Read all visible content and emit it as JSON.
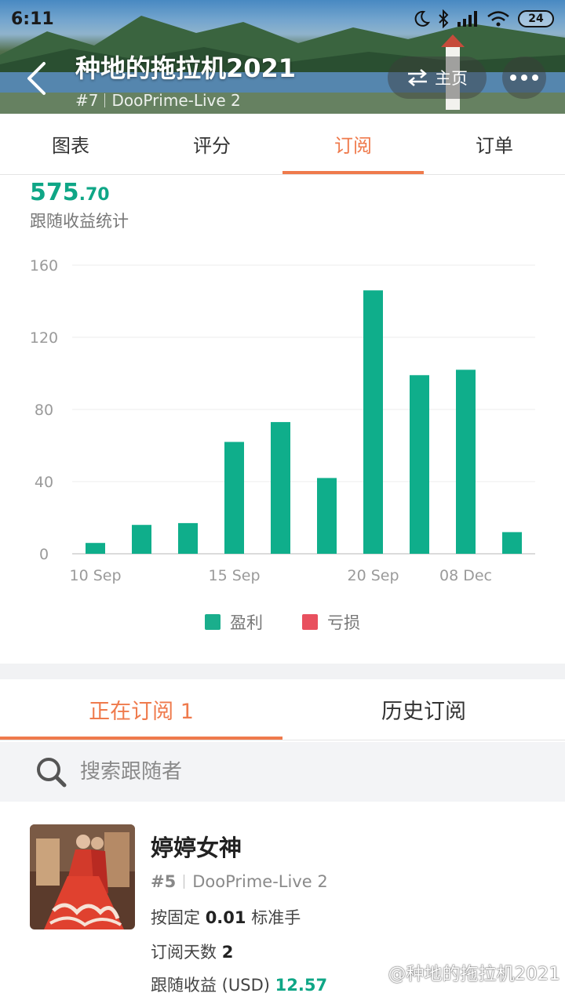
{
  "status_bar": {
    "time": "6:11",
    "battery": "24"
  },
  "header": {
    "title": "种地的拖拉机2021",
    "rank": "#7",
    "server": "DooPrime-Live 2",
    "home_label": "主页"
  },
  "tabs": [
    {
      "label": "图表",
      "active": false
    },
    {
      "label": "评分",
      "active": false
    },
    {
      "label": "订阅",
      "active": true
    },
    {
      "label": "订单",
      "active": false
    }
  ],
  "stats": {
    "value_int": "575",
    "value_dec": ".70",
    "label": "跟随收益统计"
  },
  "chart_data": {
    "type": "bar",
    "categories": [
      "10 Sep",
      "",
      "",
      "15 Sep",
      "",
      "",
      "20 Sep",
      "",
      "08 Dec",
      ""
    ],
    "series": [
      {
        "name": "盈利",
        "color": "#0fae8b",
        "values": [
          6,
          16,
          17,
          62,
          73,
          42,
          146,
          99,
          102,
          12
        ]
      },
      {
        "name": "亏损",
        "color": "#e8505e",
        "values": [
          0,
          0,
          0,
          0,
          0,
          0,
          0,
          0,
          0,
          0
        ]
      }
    ],
    "y_ticks": [
      0,
      40,
      80,
      120,
      160
    ],
    "x_tick_labels": [
      "10 Sep",
      "15 Sep",
      "20 Sep",
      "08 Dec"
    ],
    "ylim": [
      0,
      160
    ],
    "grid": true,
    "legend_position": "bottom-center"
  },
  "legend": [
    {
      "label": "盈利",
      "color": "#1aae8c"
    },
    {
      "label": "亏损",
      "color": "#e8505e"
    }
  ],
  "sub_tabs": [
    {
      "label": "正在订阅 1",
      "active": true
    },
    {
      "label": "历史订阅",
      "active": false
    }
  ],
  "search": {
    "placeholder": "搜索跟随者"
  },
  "follower": {
    "name": "婷婷女神",
    "rank": "#5",
    "server": "DooPrime-Live 2",
    "mode_prefix": "按固定",
    "mode_value": "0.01",
    "mode_suffix": "标准手",
    "days_label": "订阅天数",
    "days_value": "2",
    "profit_label": "跟随收益 (USD)",
    "profit_value": "12.57"
  },
  "watermark": "@种地的拖拉机2021"
}
